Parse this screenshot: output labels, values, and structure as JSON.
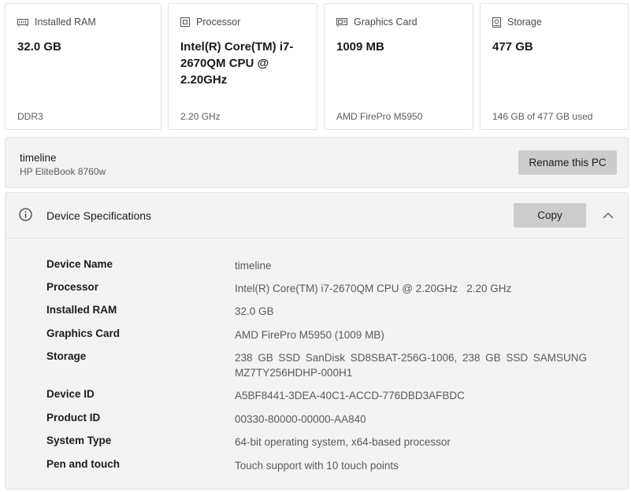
{
  "cards": [
    {
      "title": "Installed RAM",
      "icon": "ram-icon",
      "value": "32.0 GB",
      "sub": "DDR3"
    },
    {
      "title": "Processor",
      "icon": "processor-icon",
      "value": "Intel(R) Core(TM) i7-2670QM CPU @ 2.20GHz",
      "sub": "2.20 GHz"
    },
    {
      "title": "Graphics Card",
      "icon": "graphics-card-icon",
      "value": "1009 MB",
      "sub": "AMD FirePro M5950"
    },
    {
      "title": "Storage",
      "icon": "storage-icon",
      "value": "477 GB",
      "sub": "146 GB of 477 GB used"
    }
  ],
  "pc": {
    "name": "timeline",
    "model": "HP EliteBook 8760w",
    "rename_label": "Rename this PC"
  },
  "specs": {
    "title": "Device Specifications",
    "copy_label": "Copy",
    "rows": [
      {
        "key": "Device Name",
        "value": "timeline"
      },
      {
        "key": "Processor",
        "value": "Intel(R) Core(TM) i7-2670QM CPU @ 2.20GHz   2.20 GHz"
      },
      {
        "key": "Installed RAM",
        "value": "32.0 GB"
      },
      {
        "key": "Graphics Card",
        "value": "AMD FirePro M5950 (1009 MB)"
      },
      {
        "key": "Storage",
        "value": "238 GB SSD SanDisk SD8SBAT-256G-1006, 238 GB SSD SAMSUNG MZ7TY256HDHP-000H1"
      },
      {
        "key": "Device ID",
        "value": "A5BF8441-3DEA-40C1-ACCD-776DBD3AFBDC"
      },
      {
        "key": "Product ID",
        "value": "00330-80000-00000-AA840"
      },
      {
        "key": "System Type",
        "value": "64-bit operating system, x64-based processor"
      },
      {
        "key": "Pen and touch",
        "value": "Touch support with 10 touch points"
      }
    ]
  }
}
